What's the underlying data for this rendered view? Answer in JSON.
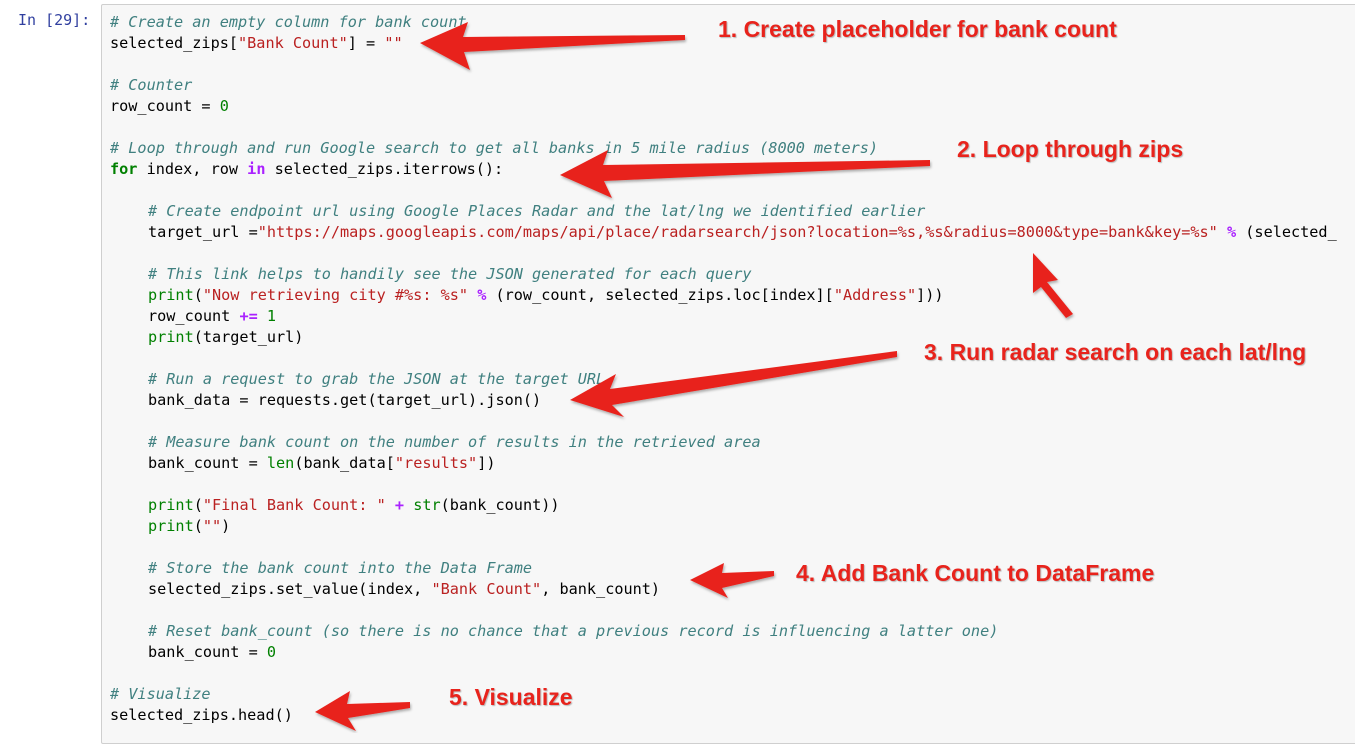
{
  "cell": {
    "prompt": "In [29]:",
    "lines": [
      {
        "indent": 0,
        "tokens": [
          {
            "t": "c",
            "v": "# Create an empty column for bank count"
          }
        ]
      },
      {
        "indent": 0,
        "tokens": [
          {
            "t": "p",
            "v": "selected_zips["
          },
          {
            "t": "s",
            "v": "\"Bank Count\""
          },
          {
            "t": "p",
            "v": "] = "
          },
          {
            "t": "s",
            "v": "\"\""
          }
        ]
      },
      {
        "indent": 0,
        "tokens": []
      },
      {
        "indent": 0,
        "tokens": [
          {
            "t": "c",
            "v": "# Counter"
          }
        ]
      },
      {
        "indent": 0,
        "tokens": [
          {
            "t": "p",
            "v": "row_count = "
          },
          {
            "t": "n",
            "v": "0"
          }
        ]
      },
      {
        "indent": 0,
        "tokens": []
      },
      {
        "indent": 0,
        "tokens": [
          {
            "t": "c",
            "v": "# Loop through and run Google search to get all banks in 5 mile radius (8000 meters)"
          }
        ]
      },
      {
        "indent": 0,
        "tokens": [
          {
            "t": "k",
            "v": "for"
          },
          {
            "t": "p",
            "v": " index, row "
          },
          {
            "t": "o",
            "v": "in"
          },
          {
            "t": "p",
            "v": " selected_zips.iterrows():"
          }
        ]
      },
      {
        "indent": 0,
        "tokens": []
      },
      {
        "indent": 1,
        "tokens": [
          {
            "t": "c",
            "v": "# Create endpoint url using Google Places Radar and the lat/lng we identified earlier"
          }
        ]
      },
      {
        "indent": 1,
        "tokens": [
          {
            "t": "p",
            "v": "target_url ="
          },
          {
            "t": "s",
            "v": "\"https://maps.googleapis.com/maps/api/place/radarsearch/json?location=%s,%s&radius=8000&type=bank&key=%s\""
          },
          {
            "t": "p",
            "v": " "
          },
          {
            "t": "o",
            "v": "%"
          },
          {
            "t": "p",
            "v": " (selected_"
          }
        ]
      },
      {
        "indent": 0,
        "tokens": []
      },
      {
        "indent": 1,
        "tokens": [
          {
            "t": "c",
            "v": "# This link helps to handily see the JSON generated for each query"
          }
        ]
      },
      {
        "indent": 1,
        "tokens": [
          {
            "t": "bi",
            "v": "print"
          },
          {
            "t": "p",
            "v": "("
          },
          {
            "t": "s",
            "v": "\"Now retrieving city #%s: %s\""
          },
          {
            "t": "p",
            "v": " "
          },
          {
            "t": "o",
            "v": "%"
          },
          {
            "t": "p",
            "v": " (row_count, selected_zips.loc[index]["
          },
          {
            "t": "s",
            "v": "\"Address\""
          },
          {
            "t": "p",
            "v": "]))"
          }
        ]
      },
      {
        "indent": 1,
        "tokens": [
          {
            "t": "p",
            "v": "row_count "
          },
          {
            "t": "o",
            "v": "+="
          },
          {
            "t": "p",
            "v": " "
          },
          {
            "t": "n",
            "v": "1"
          }
        ]
      },
      {
        "indent": 1,
        "tokens": [
          {
            "t": "bi",
            "v": "print"
          },
          {
            "t": "p",
            "v": "(target_url)"
          }
        ]
      },
      {
        "indent": 0,
        "tokens": []
      },
      {
        "indent": 1,
        "tokens": [
          {
            "t": "c",
            "v": "# Run a request to grab the JSON at the target URL"
          }
        ]
      },
      {
        "indent": 1,
        "tokens": [
          {
            "t": "p",
            "v": "bank_data = requests.get(target_url).json()"
          }
        ]
      },
      {
        "indent": 0,
        "tokens": []
      },
      {
        "indent": 1,
        "tokens": [
          {
            "t": "c",
            "v": "# Measure bank count on the number of results in the retrieved area"
          }
        ]
      },
      {
        "indent": 1,
        "tokens": [
          {
            "t": "p",
            "v": "bank_count = "
          },
          {
            "t": "bi",
            "v": "len"
          },
          {
            "t": "p",
            "v": "(bank_data["
          },
          {
            "t": "s",
            "v": "\"results\""
          },
          {
            "t": "p",
            "v": "])"
          }
        ]
      },
      {
        "indent": 0,
        "tokens": []
      },
      {
        "indent": 1,
        "tokens": [
          {
            "t": "bi",
            "v": "print"
          },
          {
            "t": "p",
            "v": "("
          },
          {
            "t": "s",
            "v": "\"Final Bank Count: \""
          },
          {
            "t": "p",
            "v": " "
          },
          {
            "t": "o",
            "v": "+"
          },
          {
            "t": "p",
            "v": " "
          },
          {
            "t": "bi",
            "v": "str"
          },
          {
            "t": "p",
            "v": "(bank_count))"
          }
        ]
      },
      {
        "indent": 1,
        "tokens": [
          {
            "t": "bi",
            "v": "print"
          },
          {
            "t": "p",
            "v": "("
          },
          {
            "t": "s",
            "v": "\"\""
          },
          {
            "t": "p",
            "v": ")"
          }
        ]
      },
      {
        "indent": 0,
        "tokens": []
      },
      {
        "indent": 1,
        "tokens": [
          {
            "t": "c",
            "v": "# Store the bank count into the Data Frame"
          }
        ]
      },
      {
        "indent": 1,
        "tokens": [
          {
            "t": "p",
            "v": "selected_zips.set_value(index, "
          },
          {
            "t": "s",
            "v": "\"Bank Count\""
          },
          {
            "t": "p",
            "v": ", bank_count)"
          }
        ]
      },
      {
        "indent": 0,
        "tokens": []
      },
      {
        "indent": 1,
        "tokens": [
          {
            "t": "c",
            "v": "# Reset bank_count (so there is no chance that a previous record is influencing a latter one)"
          }
        ]
      },
      {
        "indent": 1,
        "tokens": [
          {
            "t": "p",
            "v": "bank_count = "
          },
          {
            "t": "n",
            "v": "0"
          }
        ]
      },
      {
        "indent": 0,
        "tokens": []
      },
      {
        "indent": 0,
        "tokens": [
          {
            "t": "c",
            "v": "# Visualize"
          }
        ]
      },
      {
        "indent": 0,
        "tokens": [
          {
            "t": "p",
            "v": "selected_zips.head()"
          }
        ]
      }
    ]
  },
  "annotations": {
    "a1": "1. Create placeholder for bank count",
    "a2": "2. Loop through zips",
    "a3": "3. Run radar search on each lat/lng",
    "a4": "4. Add Bank Count to DataFrame",
    "a5": "5. Visualize"
  },
  "colors": {
    "arrow": "#e8231c",
    "prompt": "#303f9f",
    "comment": "#408080",
    "string": "#ba2121",
    "keyword": "#008000"
  }
}
